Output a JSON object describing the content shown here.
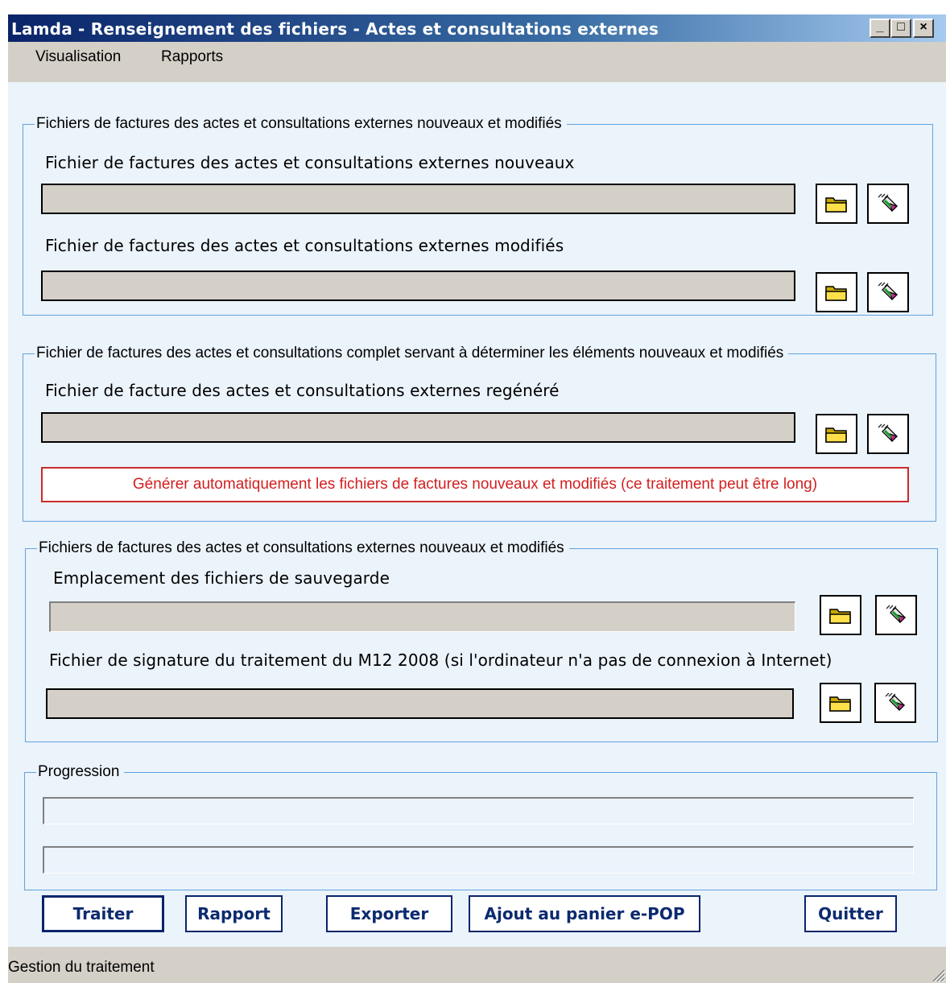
{
  "window": {
    "title": "Lamda - Renseignement des fichiers - Actes et consultations externes",
    "controls": {
      "minimize": "_",
      "maximize": "□",
      "close": "×"
    }
  },
  "menu": {
    "items": [
      "Visualisation",
      "Rapports"
    ]
  },
  "groups": {
    "factures": {
      "legend": "Fichiers de factures des actes et consultations externes nouveaux et modifiés",
      "fields": [
        {
          "label": "Fichier de factures des actes et consultations externes nouveaux",
          "value": ""
        },
        {
          "label": "Fichier de factures des actes et consultations externes modifiés",
          "value": ""
        }
      ]
    },
    "complet": {
      "legend": "Fichier de factures des actes et consultations complet servant à déterminer les éléments nouveaux et modifiés",
      "fields": [
        {
          "label": "Fichier de facture des actes et consultations externes regénéré",
          "value": ""
        }
      ],
      "generate_label": "Générer automatiquement les fichiers de factures nouveaux et modifiés (ce traitement peut être long)"
    },
    "sauvegarde": {
      "legend": "Fichiers de factures des actes et consultations externes nouveaux et modifiés",
      "fields": [
        {
          "label": "Emplacement des fichiers de sauvegarde",
          "value": ""
        },
        {
          "label": "Fichier de signature du traitement du M12 2008 (si l'ordinateur n'a pas de connexion à Internet)",
          "value": ""
        }
      ]
    },
    "progression": {
      "legend": "Progression",
      "bars": [
        0,
        0
      ]
    }
  },
  "icons": {
    "browse": "folder-icon",
    "clear": "eraser-icon"
  },
  "buttons": {
    "traiter": "Traiter",
    "rapport": "Rapport",
    "exporter": "Exporter",
    "panier": "Ajout au panier e-POP",
    "quitter": "Quitter"
  },
  "status": {
    "text": "Gestion du traitement"
  },
  "colors": {
    "title_gradient_start": "#0a246a",
    "title_gradient_end": "#a6caf0",
    "client_background": "#ebf3fb",
    "group_border": "#62a3dd",
    "generate_text": "#d21f1f",
    "button_text": "#0b2a6f"
  }
}
